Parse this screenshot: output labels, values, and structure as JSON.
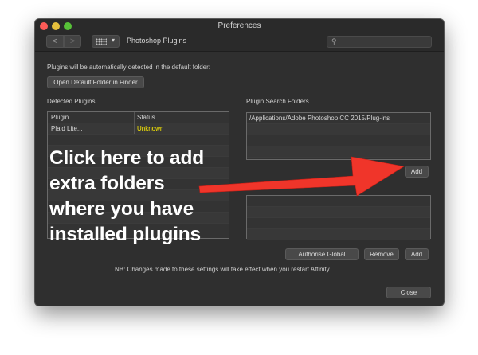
{
  "window": {
    "title": "Preferences",
    "panel_title": "Photoshop Plugins",
    "search_placeholder": ""
  },
  "toolbar": {
    "back_label": "<",
    "forward_label": ">",
    "grid_caret": "▾"
  },
  "main": {
    "auto_detect_text": "Plugins will be automatically detected in the default folder:",
    "open_folder_button": "Open Default Folder in Finder",
    "detected_heading": "Detected Plugins",
    "search_folders_heading": "Plugin Search Folders",
    "plugins_table": {
      "columns": [
        "Plugin",
        "Status"
      ],
      "rows": [
        {
          "name": "Plaid Lite...",
          "status": "Unknown"
        }
      ]
    },
    "search_folders": [
      "/Applications/Adobe Photoshop CC 2015/Plug-ins"
    ],
    "add_button": "Add",
    "authorise_button": "Authorise Global",
    "remove_button": "Remove",
    "add_button_2": "Add",
    "note": "NB: Changes made to these settings will take effect when you restart Affinity.",
    "close_button": "Close"
  },
  "annotation": {
    "lines": [
      "Click here to add",
      "extra folders",
      "where you have",
      "installed plugins"
    ],
    "arrow_color": "#f0352a"
  },
  "colors": {
    "status_unknown": "#ffee00",
    "window_bg": "#2f2f2f"
  }
}
